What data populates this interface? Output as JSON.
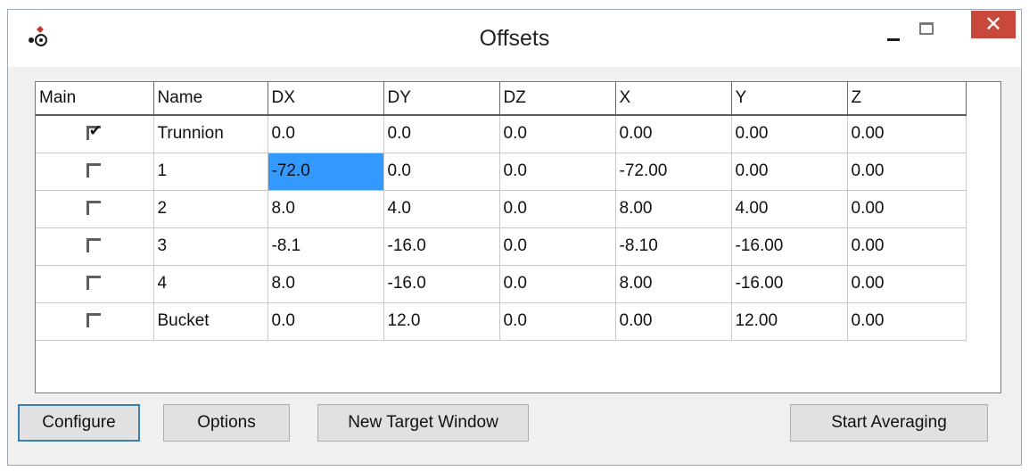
{
  "window": {
    "title": "Offsets",
    "close_glyph": "✕"
  },
  "grid": {
    "columns": [
      "Main",
      "Name",
      "DX",
      "DY",
      "DZ",
      "X",
      "Y",
      "Z"
    ],
    "rows": [
      {
        "main": true,
        "cells": [
          "Trunnion",
          "0.0",
          "0.0",
          "0.0",
          "0.00",
          "0.00",
          "0.00"
        ]
      },
      {
        "main": false,
        "cells": [
          "1",
          "-72.0",
          "0.0",
          "0.0",
          "-72.00",
          "0.00",
          "0.00"
        ]
      },
      {
        "main": false,
        "cells": [
          "2",
          "8.0",
          "4.0",
          "0.0",
          "8.00",
          "4.00",
          "0.00"
        ]
      },
      {
        "main": false,
        "cells": [
          "3",
          "-8.1",
          "-16.0",
          "0.0",
          "-8.10",
          "-16.00",
          "0.00"
        ]
      },
      {
        "main": false,
        "cells": [
          "4",
          "8.0",
          "-16.0",
          "0.0",
          "8.00",
          "-16.00",
          "0.00"
        ]
      },
      {
        "main": false,
        "cells": [
          "Bucket",
          "0.0",
          "12.0",
          "0.0",
          "0.00",
          "12.00",
          "0.00"
        ]
      }
    ],
    "selected_row": 1,
    "selected_col": 1
  },
  "buttons": {
    "configure": "Configure",
    "options": "Options",
    "new_target_window": "New Target Window",
    "start_averaging": "Start Averaging"
  },
  "colors": {
    "selection": "#3399ff",
    "close": "#c9483c"
  }
}
